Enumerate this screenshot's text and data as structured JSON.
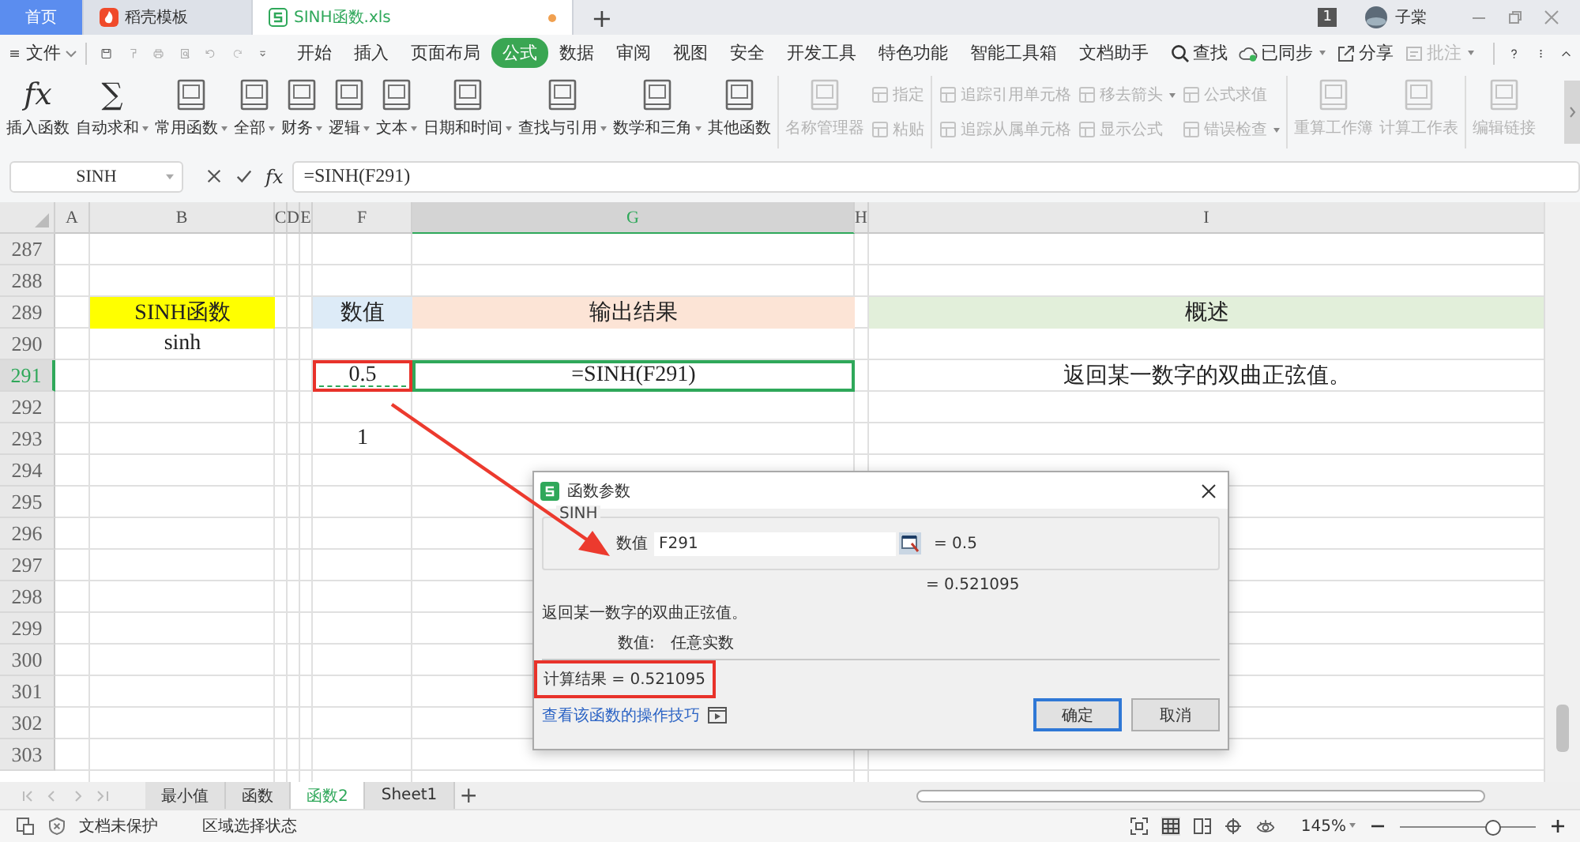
{
  "doc_tabs": [
    {
      "label": "首页",
      "kind": "home",
      "selected": false,
      "modified": false
    },
    {
      "label": "稻壳模板",
      "kind": "docer",
      "selected": false,
      "modified": false
    },
    {
      "label": "SINH函数.xls",
      "kind": "sheet",
      "selected": true,
      "modified": true
    }
  ],
  "new_tab": "+",
  "window_count": "1",
  "user": "子棠",
  "file_menu": "文件",
  "menu_tabs": [
    {
      "label": "开始",
      "selected": false
    },
    {
      "label": "插入",
      "selected": false
    },
    {
      "label": "页面布局",
      "selected": false
    },
    {
      "label": "公式",
      "selected": true
    },
    {
      "label": "数据",
      "selected": false
    },
    {
      "label": "审阅",
      "selected": false
    },
    {
      "label": "视图",
      "selected": false
    },
    {
      "label": "安全",
      "selected": false
    },
    {
      "label": "开发工具",
      "selected": false
    },
    {
      "label": "特色功能",
      "selected": false
    },
    {
      "label": "智能工具箱",
      "selected": false
    },
    {
      "label": "文档助手",
      "selected": false
    }
  ],
  "search": "查找",
  "menu_right": [
    {
      "label": "已同步",
      "kind": "sync",
      "disabled": false,
      "menu": true
    },
    {
      "label": "分享",
      "kind": "share",
      "disabled": false,
      "menu": false
    },
    {
      "label": "批注",
      "kind": "comment",
      "disabled": true,
      "menu": true
    }
  ],
  "ribbon_groups": [
    {
      "items": [
        {
          "kind": "large",
          "label": "插入函数",
          "glyph": "fx",
          "disabled": false,
          "menu": false
        },
        {
          "kind": "large",
          "label": "自动求和",
          "glyph": "∑",
          "disabled": false,
          "menu": true
        },
        {
          "kind": "large",
          "label": "常用函数",
          "disabled": false,
          "menu": true
        },
        {
          "kind": "large",
          "label": "全部",
          "disabled": false,
          "menu": true
        },
        {
          "kind": "large",
          "label": "财务",
          "disabled": false,
          "menu": true
        },
        {
          "kind": "large",
          "label": "逻辑",
          "disabled": false,
          "menu": true
        },
        {
          "kind": "large",
          "label": "文本",
          "disabled": false,
          "menu": true
        },
        {
          "kind": "large",
          "label": "日期和时间",
          "disabled": false,
          "menu": true
        },
        {
          "kind": "large",
          "label": "查找与引用",
          "disabled": false,
          "menu": true
        },
        {
          "kind": "large",
          "label": "数学和三角",
          "disabled": false,
          "menu": true
        },
        {
          "kind": "large",
          "label": "其他函数",
          "disabled": false,
          "menu": false
        }
      ]
    },
    {
      "items": [
        {
          "kind": "large",
          "label": "名称管理器",
          "disabled": true,
          "menu": false
        },
        {
          "kind": "stack",
          "items": [
            {
              "label": "指定",
              "disabled": true,
              "menu": false
            },
            {
              "label": "粘贴",
              "disabled": true,
              "menu": false
            }
          ]
        }
      ]
    },
    {
      "items": [
        {
          "kind": "stack",
          "items": [
            {
              "label": "追踪引用单元格",
              "disabled": true,
              "menu": false
            },
            {
              "label": "追踪从属单元格",
              "disabled": true,
              "menu": false
            }
          ]
        },
        {
          "kind": "stack",
          "items": [
            {
              "label": "移去箭头",
              "disabled": true,
              "menu": true
            },
            {
              "label": "显示公式",
              "disabled": true,
              "menu": false
            }
          ]
        },
        {
          "kind": "stack",
          "items": [
            {
              "label": "公式求值",
              "disabled": true,
              "menu": false
            },
            {
              "label": "错误检查",
              "disabled": true,
              "menu": true
            }
          ]
        }
      ]
    },
    {
      "items": [
        {
          "kind": "large",
          "label": "重算工作簿",
          "disabled": true,
          "menu": false
        },
        {
          "kind": "large",
          "label": "计算工作表",
          "disabled": true,
          "menu": false
        }
      ]
    },
    {
      "items": [
        {
          "kind": "large",
          "label": "编辑链接",
          "disabled": true,
          "menu": false
        }
      ]
    }
  ],
  "formula_bar": {
    "name_box": "SINH",
    "fx": "fx",
    "formula": "=SINH(F291)"
  },
  "columns": [
    {
      "label": "A",
      "selected": false
    },
    {
      "label": "B",
      "selected": false
    },
    {
      "label": "C",
      "selected": false
    },
    {
      "label": "D",
      "selected": false
    },
    {
      "label": "E",
      "selected": false
    },
    {
      "label": "F",
      "selected": false
    },
    {
      "label": "G",
      "selected": true
    },
    {
      "label": "H",
      "selected": false
    },
    {
      "label": "I",
      "selected": false
    }
  ],
  "rows": [
    {
      "number": "287",
      "selected": false
    },
    {
      "number": "288",
      "selected": false
    },
    {
      "number": "289",
      "selected": false,
      "cells": [
        null,
        {
          "text": "SINH函数",
          "color": "#ffff00",
          "highlighted": false,
          "referenced": false
        },
        null,
        null,
        null,
        {
          "text": "数值",
          "color": "#ddebf7",
          "highlighted": false,
          "referenced": false
        },
        {
          "text": "输出结果",
          "color": "#fce4d6",
          "highlighted": false,
          "referenced": false
        },
        null,
        {
          "text": "概述",
          "color": "#e2efda",
          "highlighted": false,
          "referenced": false
        }
      ]
    },
    {
      "number": "290",
      "selected": false,
      "cells": [
        null,
        {
          "text": "sinh",
          "highlighted": false,
          "referenced": false
        }
      ]
    },
    {
      "number": "291",
      "selected": true,
      "cells": [
        null,
        null,
        null,
        null,
        null,
        {
          "text": "0.5",
          "highlighted": true,
          "referenced": true
        },
        {
          "text": "=SINH(F291)",
          "highlighted": false,
          "referenced": false
        },
        null,
        {
          "text": "返回某一数字的双曲正弦值。",
          "highlighted": false,
          "referenced": false
        }
      ]
    },
    {
      "number": "292",
      "selected": false
    },
    {
      "number": "293",
      "selected": false,
      "cells": [
        null,
        null,
        null,
        null,
        null,
        {
          "text": "1",
          "highlighted": false,
          "referenced": false
        }
      ]
    },
    {
      "number": "294",
      "selected": false
    },
    {
      "number": "295",
      "selected": false
    },
    {
      "number": "296",
      "selected": false
    },
    {
      "number": "297",
      "selected": false
    },
    {
      "number": "298",
      "selected": false
    },
    {
      "number": "299",
      "selected": false
    },
    {
      "number": "300",
      "selected": false
    },
    {
      "number": "301",
      "selected": false
    },
    {
      "number": "302",
      "selected": false
    },
    {
      "number": "303",
      "selected": false
    }
  ],
  "annotation_arrow": true,
  "dialog": {
    "title": "函数参数",
    "group": "SINH",
    "arg_label": "数值",
    "arg_value": "F291",
    "arg_result": "= 0.5",
    "result_preview": "= 0.521095",
    "description": "返回某一数字的双曲正弦值。",
    "help_label": "数值:",
    "help_text": "任意实数",
    "result": "计算结果 =  0.521095",
    "result_highlighted": true,
    "link": "查看该函数的操作技巧",
    "buttons": [
      {
        "label": "确定",
        "default": true
      },
      {
        "label": "取消",
        "default": false
      }
    ]
  },
  "sheet_tabs": [
    {
      "label": "最小值",
      "selected": false
    },
    {
      "label": "函数",
      "selected": false
    },
    {
      "label": "函数2",
      "selected": true
    },
    {
      "label": "Sheet1",
      "selected": false
    }
  ],
  "add_sheet": "+",
  "status_bar": {
    "protection": "文档未保护",
    "selection_mode": "区域选择状态",
    "zoom": "145%",
    "zoom_slider": {
      "level": 0.67
    }
  }
}
